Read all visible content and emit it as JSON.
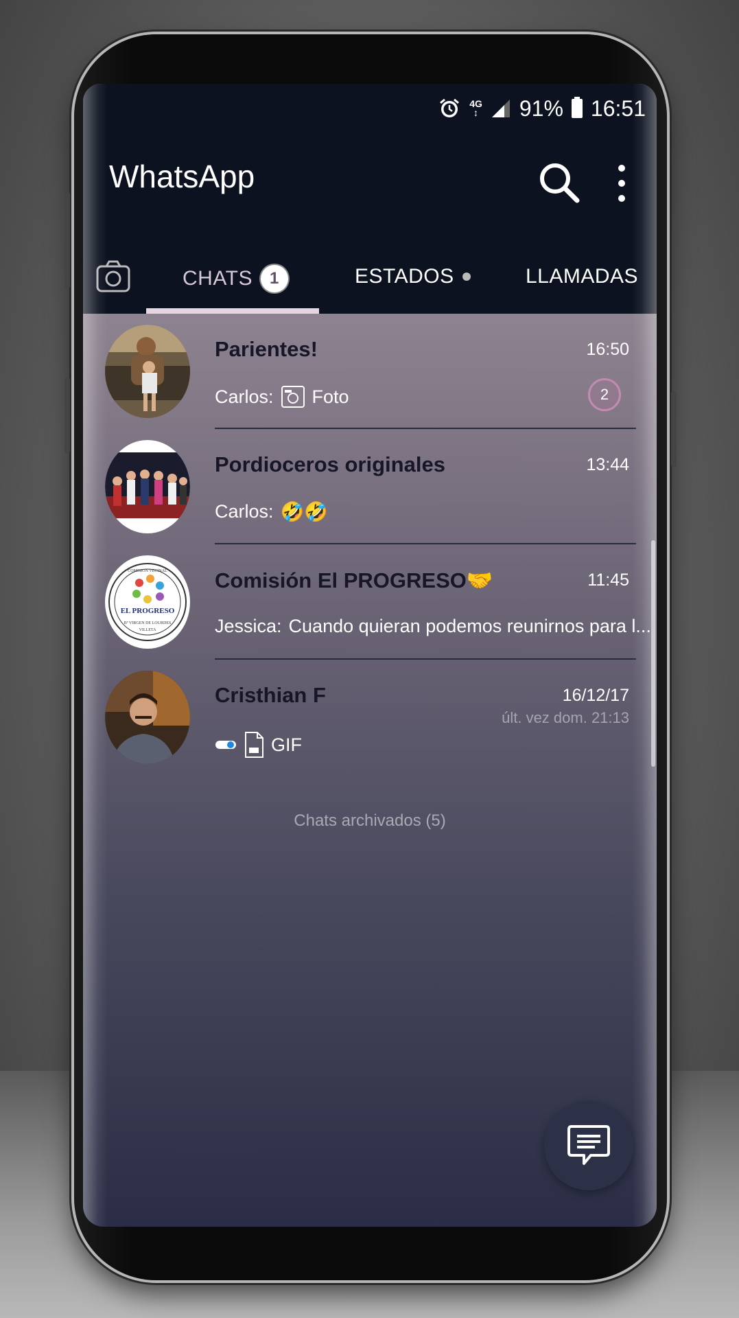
{
  "status_bar": {
    "network": "4G",
    "battery": "91%",
    "time": "16:51",
    "icons": [
      "alarm-icon",
      "signal-icon",
      "battery-icon"
    ]
  },
  "app": {
    "title": "WhatsApp",
    "icons": [
      "search-icon",
      "more-icon",
      "camera-icon"
    ]
  },
  "tabs": [
    {
      "label": "CHATS",
      "badge": "1",
      "active": true
    },
    {
      "label": "ESTADOS",
      "dot": true
    },
    {
      "label": "LLAMADAS"
    }
  ],
  "chats": [
    {
      "name": "Parientes!",
      "time": "16:50",
      "sender": "Carlos:",
      "preview": "Foto",
      "preview_icon": "camera-small-icon",
      "unread": "2"
    },
    {
      "name": "Pordioceros originales",
      "time": "13:44",
      "sender": "Carlos:",
      "preview": "🤣🤣"
    },
    {
      "name": "Comisión El PROGRESO🤝",
      "time": "11:45",
      "sender": "Jessica:",
      "preview": "Cuando quieran podemos reunirnos para l..."
    },
    {
      "name": "Cristhian F",
      "time": "16/12/17",
      "last_seen": "últ. vez dom. 21:13",
      "preview": "GIF",
      "preview_icon": "gif-file-icon"
    }
  ],
  "avatar_text": {
    "top": "COMISION VECINAL",
    "main": "EL PROGRESO",
    "bottom": "Bº VIRGEN DE LOURDES",
    "city": "VILLETA"
  },
  "archived": "Chats archivados (5)",
  "colors": {
    "header": "#0d1220",
    "accent": "#e5d6e2",
    "unread_ring": "#c48bb1"
  }
}
